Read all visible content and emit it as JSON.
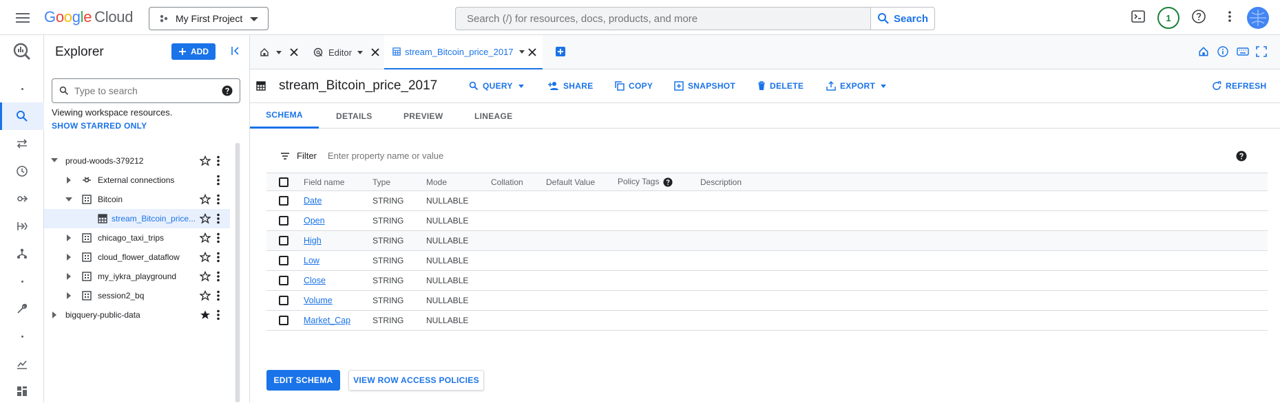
{
  "topbar": {
    "logo_google": "Google",
    "logo_cloud": "Cloud",
    "project_name": "My First Project",
    "search_placeholder": "Search (/) for resources, docs, products, and more",
    "search_button": "Search",
    "notifications_count": "1"
  },
  "colors": {
    "accent": "#1a73e8",
    "badge": "#188038",
    "selected_bg": "#e8f0fe"
  },
  "rail": {
    "icons": [
      "bigquery-logo-icon",
      "dot",
      "search-icon",
      "transfers-icon",
      "history-icon",
      "analytics-hub-icon",
      "dataform-icon",
      "pipelines-icon",
      "dot",
      "wrench-icon",
      "dot",
      "chart-icon",
      "grid-icon"
    ]
  },
  "explorer": {
    "title": "Explorer",
    "add_button": "ADD",
    "search_placeholder": "Type to search",
    "viewing_text": "Viewing workspace resources.",
    "starred_link": "SHOW STARRED ONLY",
    "tree": [
      {
        "label": "proud-woods-379212",
        "level": 0,
        "expanded": true,
        "starred": false
      },
      {
        "label": "External connections",
        "level": 1,
        "expanded": false,
        "type": "connection"
      },
      {
        "label": "Bitcoin",
        "level": 1,
        "expanded": true,
        "type": "dataset",
        "starred": false
      },
      {
        "label": "stream_Bitcoin_price...",
        "level": 2,
        "type": "table",
        "selected": true,
        "starred": false
      },
      {
        "label": "chicago_taxi_trips",
        "level": 1,
        "expanded": false,
        "type": "dataset",
        "starred": false
      },
      {
        "label": "cloud_flower_dataflow",
        "level": 1,
        "expanded": false,
        "type": "dataset",
        "starred": false
      },
      {
        "label": "my_iykra_playground",
        "level": 1,
        "expanded": false,
        "type": "dataset",
        "starred": false
      },
      {
        "label": "session2_bq",
        "level": 1,
        "expanded": false,
        "type": "dataset",
        "starred": false
      },
      {
        "label": "bigquery-public-data",
        "level": 0,
        "expanded": false,
        "starred": true
      }
    ]
  },
  "tabs": [
    {
      "label": "",
      "icon": "home-icon"
    },
    {
      "label": "Editor",
      "icon": "query-icon"
    },
    {
      "label": "stream_Bitcoin_price_2017",
      "icon": "table-icon",
      "active": true
    }
  ],
  "toolbar": {
    "title": "stream_Bitcoin_price_2017",
    "query": "QUERY",
    "share": "SHARE",
    "copy": "COPY",
    "snapshot": "SNAPSHOT",
    "delete": "DELETE",
    "export": "EXPORT",
    "refresh": "REFRESH"
  },
  "subtabs": [
    "SCHEMA",
    "DETAILS",
    "PREVIEW",
    "LINEAGE"
  ],
  "filter": {
    "label": "Filter",
    "placeholder": "Enter property name or value"
  },
  "schema": {
    "headers": [
      "Field name",
      "Type",
      "Mode",
      "Collation",
      "Default Value",
      "Policy Tags",
      "Description"
    ],
    "rows": [
      {
        "name": "Date",
        "type": "STRING",
        "mode": "NULLABLE"
      },
      {
        "name": "Open",
        "type": "STRING",
        "mode": "NULLABLE"
      },
      {
        "name": "High",
        "type": "STRING",
        "mode": "NULLABLE"
      },
      {
        "name": "Low",
        "type": "STRING",
        "mode": "NULLABLE"
      },
      {
        "name": "Close",
        "type": "STRING",
        "mode": "NULLABLE"
      },
      {
        "name": "Volume",
        "type": "STRING",
        "mode": "NULLABLE"
      },
      {
        "name": "Market_Cap",
        "type": "STRING",
        "mode": "NULLABLE"
      }
    ]
  },
  "buttons": {
    "edit_schema": "EDIT SCHEMA",
    "row_access": "VIEW ROW ACCESS POLICIES"
  }
}
